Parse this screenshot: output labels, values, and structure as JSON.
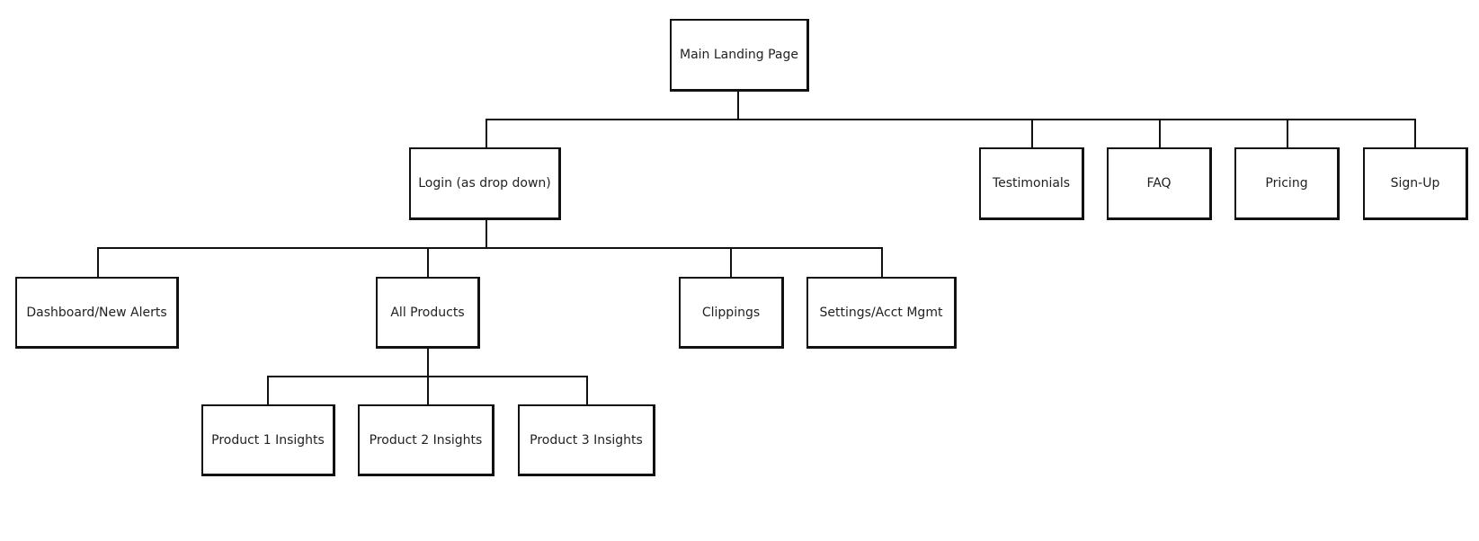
{
  "diagram": {
    "type": "sitemap",
    "root": {
      "label": "Main Landing Page",
      "children": [
        "Login (as drop down)",
        "Testimonials",
        "FAQ",
        "Pricing",
        "Sign-Up"
      ]
    },
    "nodes": {
      "main": "Main Landing Page",
      "login": "Login (as drop down)",
      "testimonials": "Testimonials",
      "faq": "FAQ",
      "pricing": "Pricing",
      "signup": "Sign-Up",
      "dashboard": "Dashboard/New Alerts",
      "all_products": "All Products",
      "clippings": "Clippings",
      "settings": "Settings/Acct Mgmt",
      "product1": "Product 1 Insights",
      "product2": "Product 2 Insights",
      "product3": "Product 3 Insights"
    },
    "edges": [
      [
        "main",
        "login"
      ],
      [
        "main",
        "testimonials"
      ],
      [
        "main",
        "faq"
      ],
      [
        "main",
        "pricing"
      ],
      [
        "main",
        "signup"
      ],
      [
        "login",
        "dashboard"
      ],
      [
        "login",
        "all_products"
      ],
      [
        "login",
        "clippings"
      ],
      [
        "login",
        "settings"
      ],
      [
        "all_products",
        "product1"
      ],
      [
        "all_products",
        "product2"
      ],
      [
        "all_products",
        "product3"
      ]
    ]
  }
}
